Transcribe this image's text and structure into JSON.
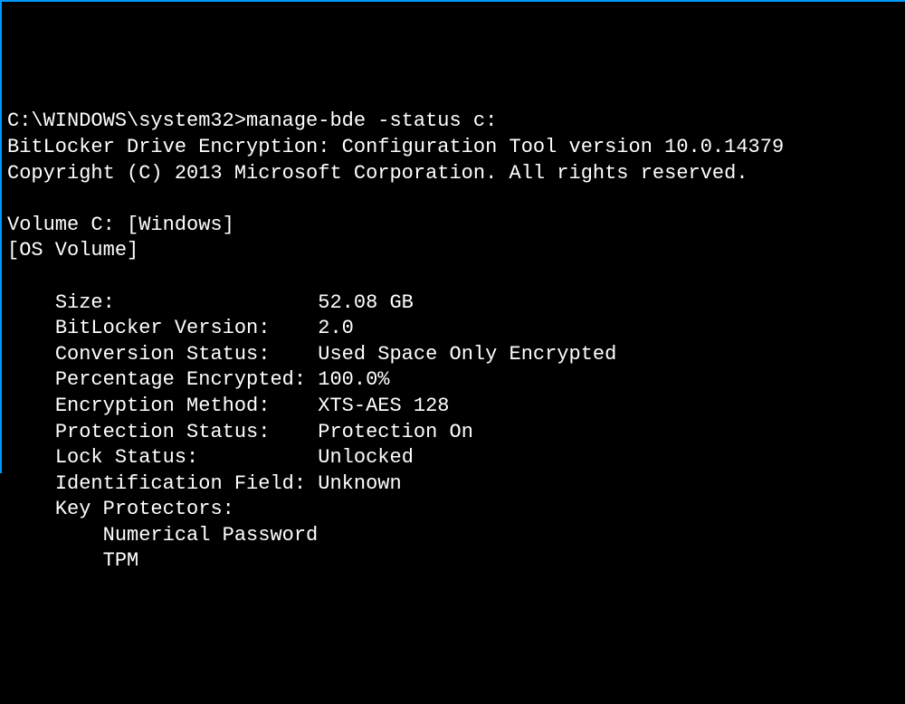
{
  "terminal": {
    "prompt": "C:\\WINDOWS\\system32>",
    "command": "manage-bde -status c:",
    "header_line1": "BitLocker Drive Encryption: Configuration Tool version 10.0.14379",
    "header_line2": "Copyright (C) 2013 Microsoft Corporation. All rights reserved.",
    "volume_line": "Volume C: [Windows]",
    "os_volume_line": "[OS Volume]",
    "fields": {
      "size_label": "Size:",
      "size_value": "52.08 GB",
      "bitlocker_version_label": "BitLocker Version:",
      "bitlocker_version_value": "2.0",
      "conversion_status_label": "Conversion Status:",
      "conversion_status_value": "Used Space Only Encrypted",
      "percentage_encrypted_label": "Percentage Encrypted:",
      "percentage_encrypted_value": "100.0%",
      "encryption_method_label": "Encryption Method:",
      "encryption_method_value": "XTS-AES 128",
      "protection_status_label": "Protection Status:",
      "protection_status_value": "Protection On",
      "lock_status_label": "Lock Status:",
      "lock_status_value": "Unlocked",
      "identification_field_label": "Identification Field:",
      "identification_field_value": "Unknown",
      "key_protectors_label": "Key Protectors:",
      "key_protector_1": "Numerical Password",
      "key_protector_2": "TPM"
    }
  }
}
